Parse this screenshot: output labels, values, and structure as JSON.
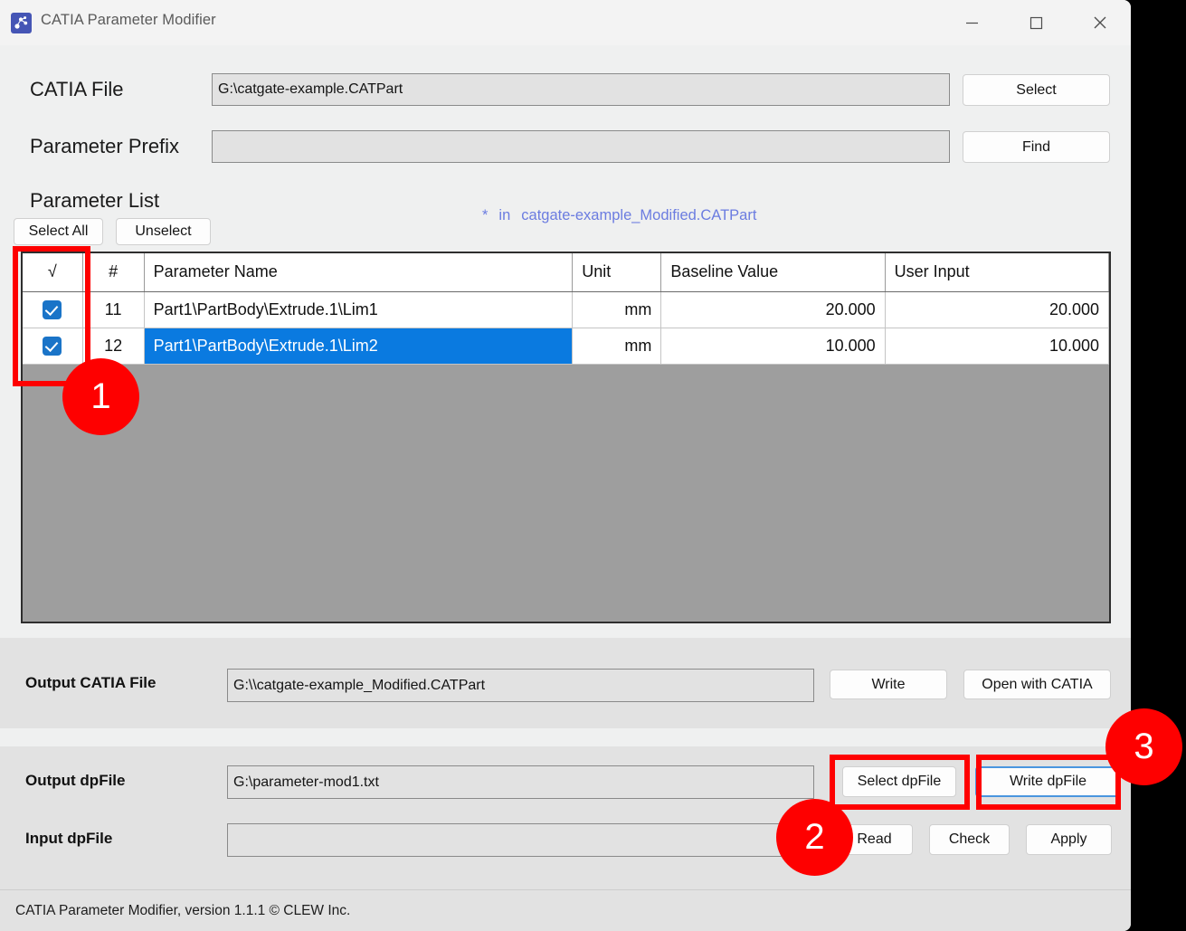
{
  "window": {
    "title": "CATIA Parameter Modifier",
    "icon": "app-dots-icon",
    "controls": {
      "minimize": "minimize-icon",
      "maximize": "maximize-icon",
      "close": "close-icon"
    }
  },
  "form": {
    "catia_file_label": "CATIA File",
    "catia_file_value": "G:\\catgate-example.CATPart",
    "catia_file_button": "Select",
    "parameter_prefix_label": "Parameter Prefix",
    "parameter_prefix_value": "",
    "parameter_prefix_placeholder": "",
    "parameter_prefix_button": "Find"
  },
  "parameter_list": {
    "title": "Parameter List",
    "select_all_label": "Select All",
    "unselect_label": "Unselect",
    "note_star": "*",
    "note_in": "in",
    "note_file": "catgate-example_Modified.CATPart",
    "columns": [
      "√",
      "#",
      "Parameter Name",
      "Unit",
      "Baseline Value",
      "User Input"
    ],
    "rows": [
      {
        "checked": true,
        "index": "11",
        "name": "Part1\\PartBody\\Extrude.1\\Lim1",
        "unit": "mm",
        "baseline": "20.000",
        "user_input": "20.000",
        "selected": false
      },
      {
        "checked": true,
        "index": "12",
        "name": "Part1\\PartBody\\Extrude.1\\Lim2",
        "unit": "mm",
        "baseline": "10.000",
        "user_input": "10.000",
        "selected": true
      }
    ]
  },
  "output": {
    "catia_file_label": "Output CATIA File",
    "catia_file_value": "G:\\\\catgate-example_Modified.CATPart",
    "write_button": "Write",
    "open_button": "Open with CATIA",
    "dpfile_label": "Output dpFile",
    "dpfile_value": "G:\\parameter-mod1.txt",
    "select_dpfile_button": "Select dpFile",
    "write_dpfile_button": "Write dpFile"
  },
  "input": {
    "dpfile_label": "Input dpFile",
    "dpfile_value": "",
    "dpfile_placeholder": "",
    "read_button": "Read",
    "check_button": "Check",
    "apply_button": "Apply"
  },
  "status_bar": {
    "text": "CATIA Parameter Modifier, version 1.1.1 © CLEW Inc."
  },
  "annotations": {
    "color": "#FE0000",
    "markers": [
      {
        "number": "1",
        "target": "checkbox-column"
      },
      {
        "number": "2",
        "target": "select-dpfile-button"
      },
      {
        "number": "3",
        "target": "write-dpfile-button"
      }
    ]
  },
  "colors": {
    "accent_blue": "#0A7AE0",
    "checkbox_blue": "#1A74C8",
    "note_blue": "#6B7CE0",
    "annotation_red": "#FE0000",
    "table_empty_gray": "#9E9E9E"
  }
}
